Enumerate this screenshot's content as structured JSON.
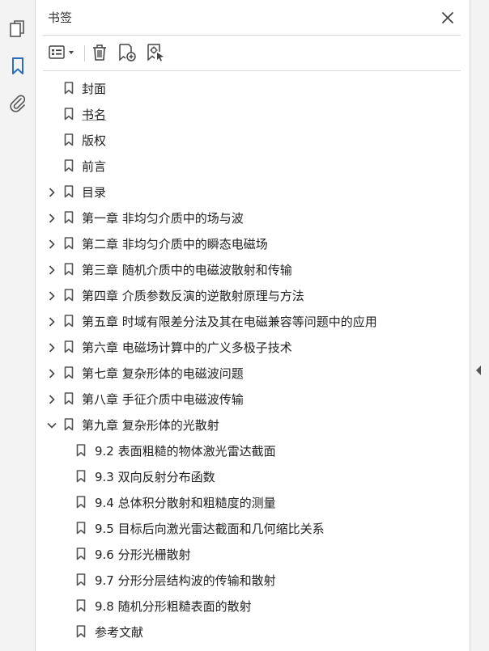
{
  "panel": {
    "title": "书签",
    "close_icon": "close-icon"
  },
  "left_rail": {
    "items": [
      {
        "name": "pages-icon",
        "active": false
      },
      {
        "name": "bookmark-icon",
        "active": true
      },
      {
        "name": "attachment-icon",
        "active": false
      }
    ]
  },
  "toolbar": {
    "items": [
      "options-menu-icon",
      "delete-icon",
      "new-bookmark-icon",
      "bookmark-from-selection-icon"
    ]
  },
  "colors": {
    "accent": "#2a6ebb",
    "icon": "#555555",
    "text": "#222222"
  },
  "bookmarks": [
    {
      "label": "封面",
      "level": 0,
      "expandable": false
    },
    {
      "label": "书名",
      "level": 0,
      "expandable": false,
      "hovered": true
    },
    {
      "label": "版权",
      "level": 0,
      "expandable": false
    },
    {
      "label": "前言",
      "level": 0,
      "expandable": false
    },
    {
      "label": "目录",
      "level": 0,
      "expandable": true,
      "expanded": false
    },
    {
      "label": "第一章  非均匀介质中的场与波",
      "level": 0,
      "expandable": true,
      "expanded": false
    },
    {
      "label": "第二章  非均匀介质中的瞬态电磁场",
      "level": 0,
      "expandable": true,
      "expanded": false
    },
    {
      "label": "第三章  随机介质中的电磁波散射和传输",
      "level": 0,
      "expandable": true,
      "expanded": false
    },
    {
      "label": "第四章  介质参数反演的逆散射原理与方法",
      "level": 0,
      "expandable": true,
      "expanded": false
    },
    {
      "label": "第五章  时域有限差分法及其在电磁兼容等问题中的应用",
      "level": 0,
      "expandable": true,
      "expanded": false
    },
    {
      "label": "第六章  电磁场计算中的广义多极子技术",
      "level": 0,
      "expandable": true,
      "expanded": false
    },
    {
      "label": "第七章  复杂形体的电磁波问题",
      "level": 0,
      "expandable": true,
      "expanded": false
    },
    {
      "label": "第八章  手征介质中电磁波传输",
      "level": 0,
      "expandable": true,
      "expanded": false
    },
    {
      "label": "第九章  复杂形体的光散射",
      "level": 0,
      "expandable": true,
      "expanded": true
    },
    {
      "label": "9.2  表面粗糙的物体激光雷达截面",
      "level": 1,
      "expandable": false
    },
    {
      "label": "9.3  双向反射分布函数",
      "level": 1,
      "expandable": false
    },
    {
      "label": "9.4  总体积分散射和粗糙度的测量",
      "level": 1,
      "expandable": false
    },
    {
      "label": "9.5  目标后向激光雷达截面和几何缩比关系",
      "level": 1,
      "expandable": false
    },
    {
      "label": "9.6  分形光栅散射",
      "level": 1,
      "expandable": false
    },
    {
      "label": "9.7  分形分层结构波的传输和散射",
      "level": 1,
      "expandable": false
    },
    {
      "label": "9.8  随机分形粗糙表面的散射",
      "level": 1,
      "expandable": false
    },
    {
      "label": "参考文献",
      "level": 1,
      "expandable": false
    }
  ]
}
